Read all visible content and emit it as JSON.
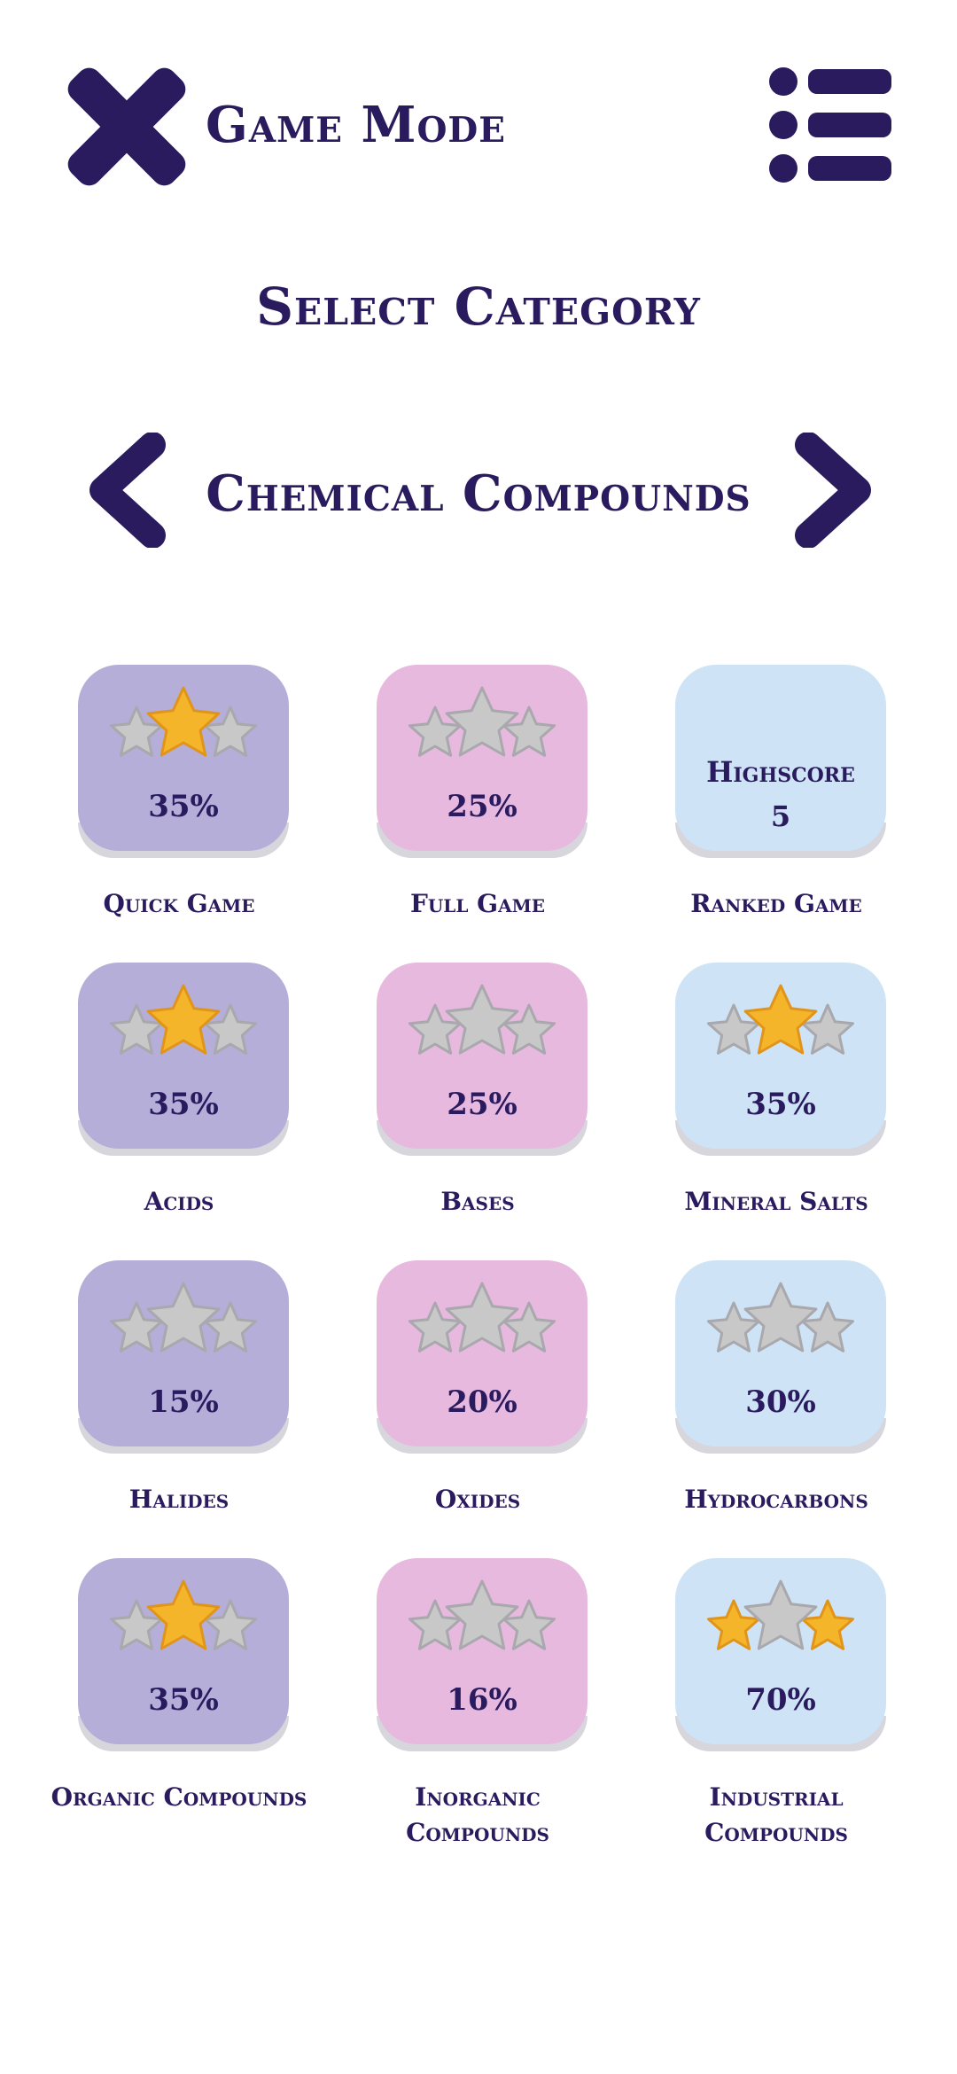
{
  "header": {
    "title": "Game Mode"
  },
  "subtitle": "Select Category",
  "category": {
    "name": "Chemical Compounds"
  },
  "colors": {
    "primary": "#2a1a5e",
    "purple": "#b4aed8",
    "pink": "#e8b9df",
    "blue": "#cfe3f6",
    "gold": "#f5b52a",
    "grey": "#c8c8c8"
  },
  "tiles": [
    {
      "label": "Quick Game",
      "value": "35%",
      "stars": [
        0,
        1,
        0
      ],
      "color": "purple"
    },
    {
      "label": "Full Game",
      "value": "25%",
      "stars": [
        0,
        0,
        0
      ],
      "color": "pink"
    },
    {
      "label": "Ranked Game",
      "highscore_label": "Highscore",
      "highscore": "5",
      "color": "blue"
    },
    {
      "label": "Acids",
      "value": "35%",
      "stars": [
        0,
        1,
        0
      ],
      "color": "purple"
    },
    {
      "label": "Bases",
      "value": "25%",
      "stars": [
        0,
        0,
        0
      ],
      "color": "pink"
    },
    {
      "label": "Mineral Salts",
      "value": "35%",
      "stars": [
        0,
        1,
        0
      ],
      "color": "blue"
    },
    {
      "label": "Halides",
      "value": "15%",
      "stars": [
        0,
        0,
        0
      ],
      "color": "purple"
    },
    {
      "label": "Oxides",
      "value": "20%",
      "stars": [
        0,
        0,
        0
      ],
      "color": "pink"
    },
    {
      "label": "Hydrocarbons",
      "value": "30%",
      "stars": [
        0,
        0,
        0
      ],
      "color": "blue"
    },
    {
      "label": "Organic Compounds",
      "value": "35%",
      "stars": [
        0,
        1,
        0
      ],
      "color": "purple"
    },
    {
      "label": "Inorganic Compounds",
      "value": "16%",
      "stars": [
        0,
        0,
        0
      ],
      "color": "pink"
    },
    {
      "label": "Industrial Compounds",
      "value": "70%",
      "stars": [
        1,
        0,
        1
      ],
      "color": "blue"
    }
  ]
}
